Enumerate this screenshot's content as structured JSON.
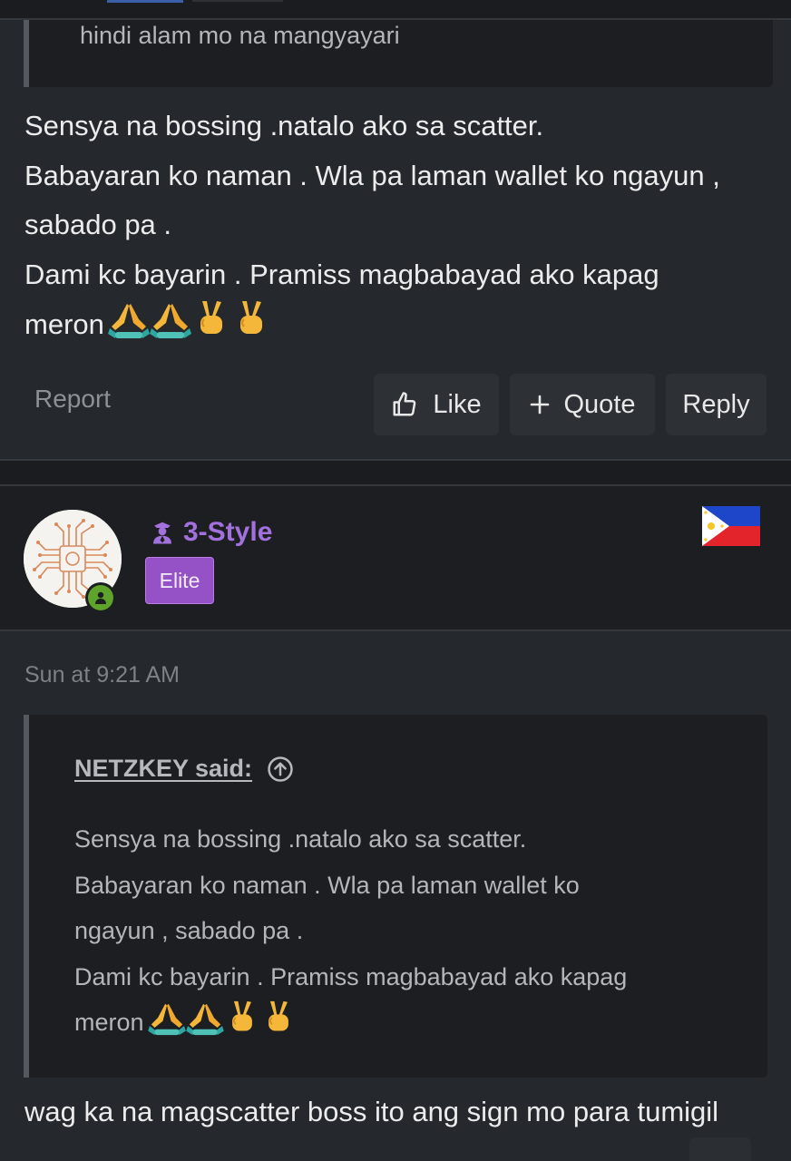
{
  "previous_post": {
    "quote_tail": "hindi alam mo na mangyayari",
    "body_lines": [
      "Sensya na bossing .natalo ako sa scatter.",
      "Babayaran ko naman . Wla pa laman wallet ko ngayun ,",
      "sabado pa .",
      "Dami kc bayarin . Pramiss magbabayad ako kapag",
      "meron"
    ],
    "emoji_names": [
      "folded-hands-emoji",
      "folded-hands-emoji",
      "victory-hand-emoji",
      "victory-hand-emoji"
    ],
    "actions": {
      "report": "Report",
      "like": "Like",
      "quote": "Quote",
      "reply": "Reply"
    }
  },
  "user": {
    "name": "3-Style",
    "badge": "Elite",
    "online": true,
    "name_color": "#a271dd",
    "badge_color": "#9552c7",
    "flag": "philippines-flag"
  },
  "post": {
    "time": "Sun at 9:21 AM",
    "quote": {
      "attribution": "NETZKEY said:",
      "lines": [
        "Sensya na bossing .natalo ako sa scatter.",
        "Babayaran ko naman . Wla pa laman wallet ko",
        "ngayun , sabado pa .",
        "Dami kc bayarin . Pramiss magbabayad ako kapag",
        "meron"
      ]
    },
    "body": "wag ka na magscatter boss ito ang sign mo para tumigil"
  },
  "icons": {
    "like": "thumbs-up-icon",
    "quote": "plus-icon",
    "expand_quote": "arrow-up-circle-icon",
    "user_class": "person-icon",
    "online": "online-status-icon"
  },
  "colors": {
    "background": "#25282c",
    "panel": "#1c1e21",
    "button": "#2d3035",
    "online": "#5ea32a"
  }
}
